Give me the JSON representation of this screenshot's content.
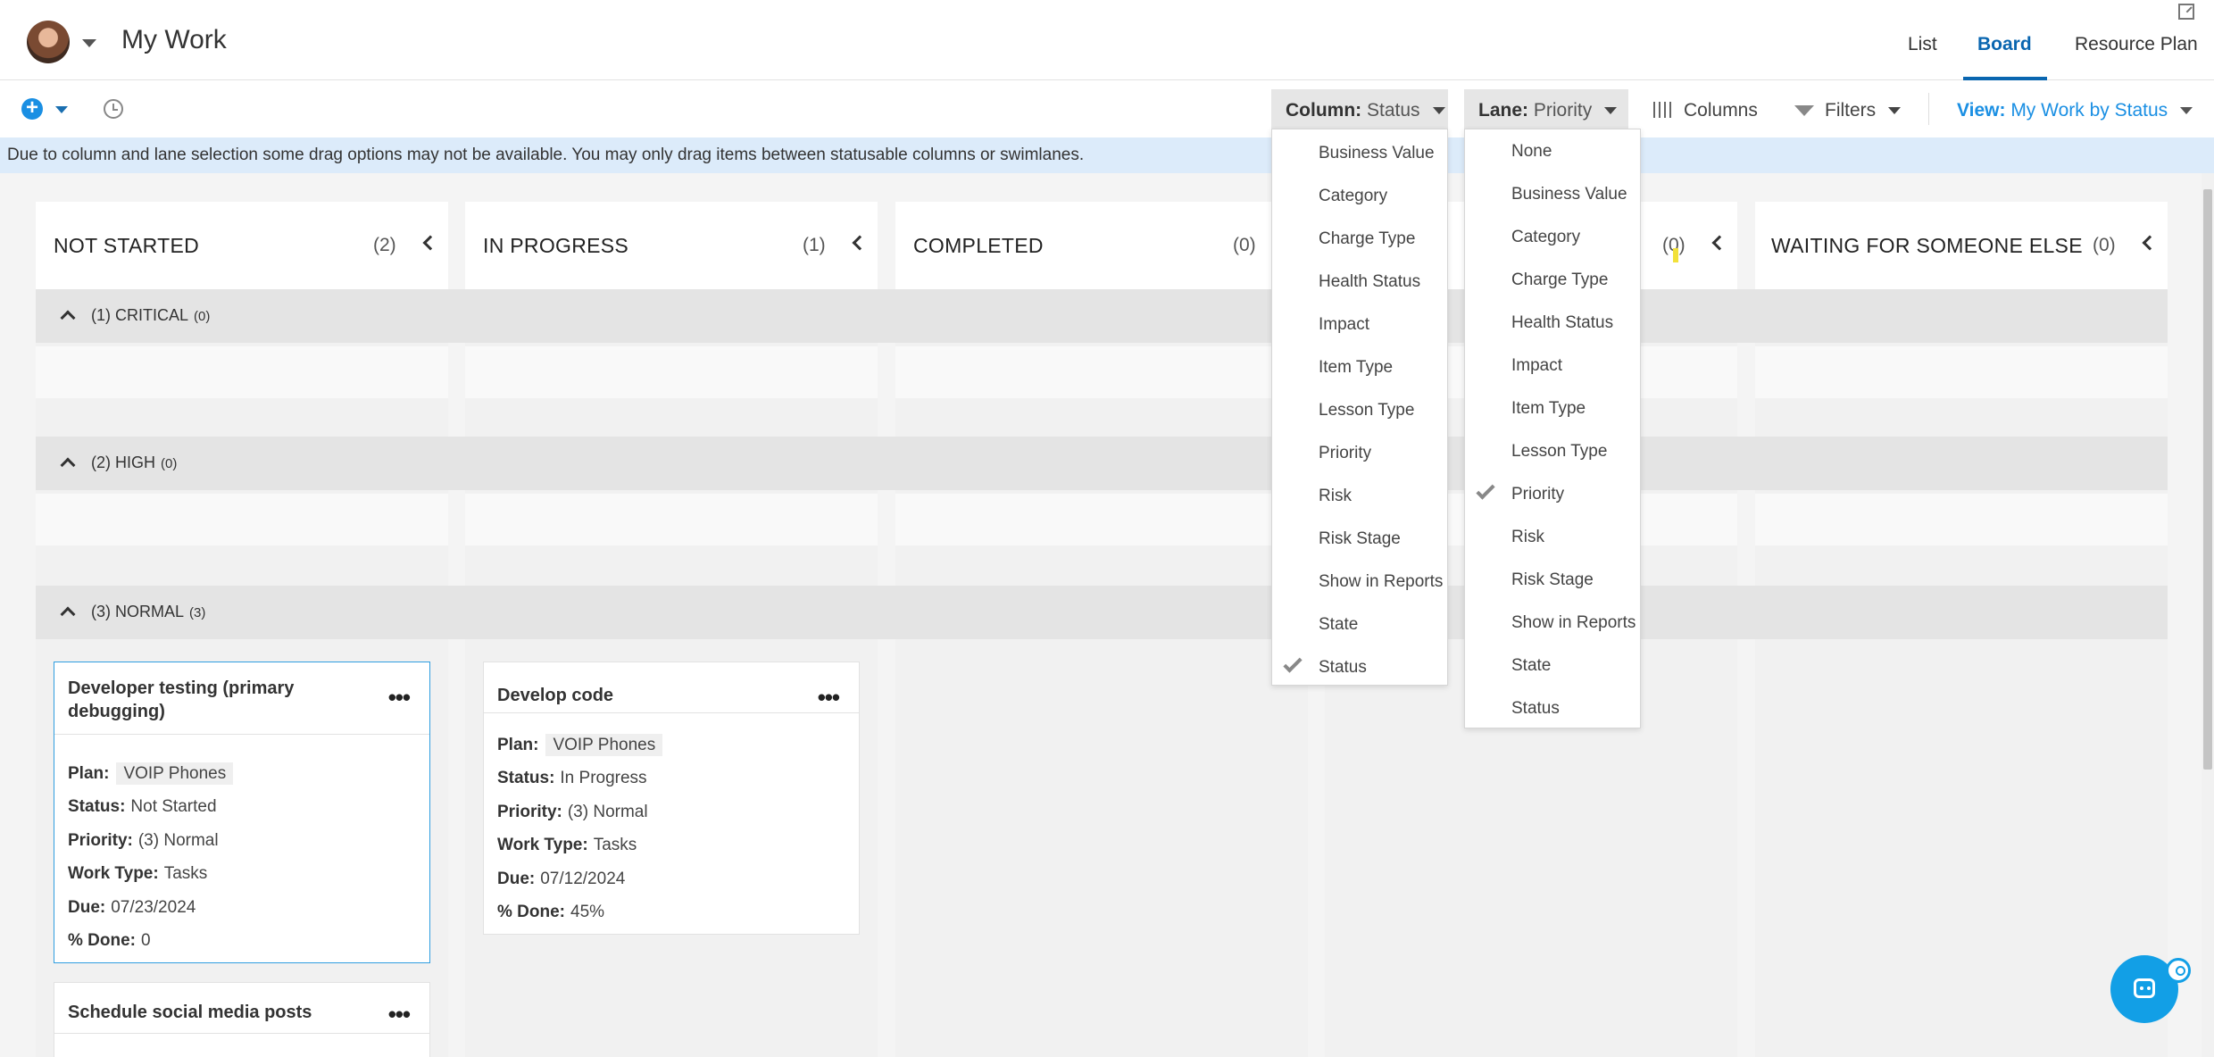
{
  "header": {
    "title": "My Work",
    "tabs": [
      {
        "label": "List"
      },
      {
        "label": "Board"
      },
      {
        "label": "Resource Plan"
      }
    ]
  },
  "toolbar": {
    "column_prefix": "Column:",
    "column_value": "Status",
    "lane_prefix": "Lane:",
    "lane_value": "Priority",
    "columns_label": "Columns",
    "filters_label": "Filters",
    "view_prefix": "View:",
    "view_value": "My Work by Status"
  },
  "banner": {
    "text": "Due to column and lane selection some drag options may not be available. You may only drag items between statusable columns or swimlanes."
  },
  "columns": [
    {
      "name": "NOT STARTED",
      "count": "(2)"
    },
    {
      "name": "IN PROGRESS",
      "count": "(1)"
    },
    {
      "name": "COMPLETED",
      "count": "(0)"
    },
    {
      "name": "",
      "count": "(0)"
    },
    {
      "name": "WAITING FOR SOMEONE ELSE",
      "count": "(0)"
    }
  ],
  "lanes": [
    {
      "label": "(1) CRITICAL",
      "count": "(0)"
    },
    {
      "label": "(2) HIGH",
      "count": "(0)"
    },
    {
      "label": "(3) NORMAL",
      "count": "(3)"
    }
  ],
  "cards": [
    {
      "title": "Developer testing (primary debugging)",
      "plan_label": "Plan:",
      "plan": "VOIP Phones",
      "status_label": "Status:",
      "status": "Not Started",
      "priority_label": "Priority:",
      "priority": "(3) Normal",
      "worktype_label": "Work Type:",
      "worktype": "Tasks",
      "due_label": "Due:",
      "due": "07/23/2024",
      "done_label": "% Done:",
      "done": "0"
    },
    {
      "title": "Develop code",
      "plan_label": "Plan:",
      "plan": "VOIP Phones",
      "status_label": "Status:",
      "status": "In Progress",
      "priority_label": "Priority:",
      "priority": "(3) Normal",
      "worktype_label": "Work Type:",
      "worktype": "Tasks",
      "due_label": "Due:",
      "due": "07/12/2024",
      "done_label": "% Done:",
      "done": "45%"
    },
    {
      "title": "Schedule social media posts"
    }
  ],
  "column_menu": {
    "items": [
      "Business Value",
      "Category",
      "Charge Type",
      "Health Status",
      "Impact",
      "Item Type",
      "Lesson Type",
      "Priority",
      "Risk",
      "Risk Stage",
      "Show in Reports",
      "State",
      "Status"
    ],
    "selected": "Status"
  },
  "lane_menu": {
    "items": [
      "None",
      "Business Value",
      "Category",
      "Charge Type",
      "Health Status",
      "Impact",
      "Item Type",
      "Lesson Type",
      "Priority",
      "Risk",
      "Risk Stage",
      "Show in Reports",
      "State",
      "Status"
    ],
    "selected": "Priority"
  },
  "icons": {
    "add": "plus-circle-icon",
    "history": "clock-icon",
    "columns": "columns-icon",
    "filters": "funnel-icon",
    "assistant": "bot-icon",
    "expand": "expand-icon"
  },
  "colors": {
    "accent": "#0a66b0",
    "link": "#1a8fe3",
    "banner": "#dcebfa",
    "selected_card_border": "#2f9ee0"
  }
}
